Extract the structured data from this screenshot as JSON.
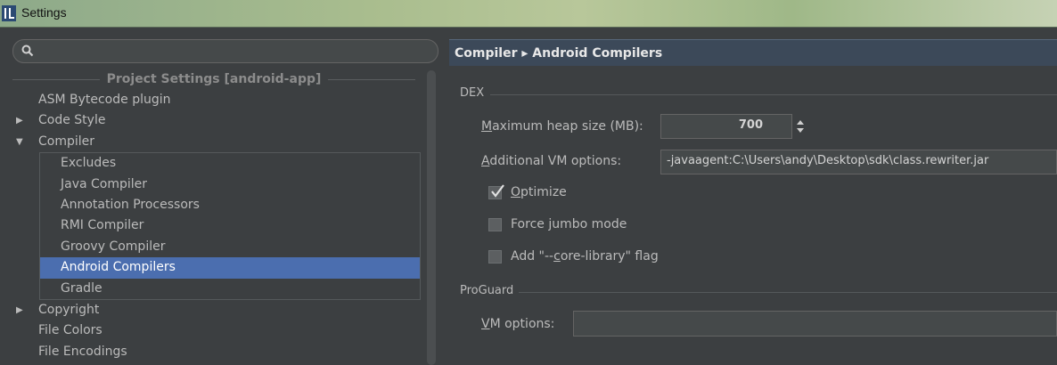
{
  "window": {
    "title": "Settings"
  },
  "search": {
    "placeholder": ""
  },
  "sidebar": {
    "section_title": "Project Settings [android-app]",
    "items": [
      {
        "label": "ASM Bytecode plugin",
        "arrow": ""
      },
      {
        "label": "Code Style",
        "arrow": "▶"
      },
      {
        "label": "Compiler",
        "arrow": "▼"
      }
    ],
    "compiler_children": [
      {
        "label": "Excludes"
      },
      {
        "label": "Java Compiler"
      },
      {
        "label": "Annotation Processors"
      },
      {
        "label": "RMI Compiler"
      },
      {
        "label": "Groovy Compiler"
      },
      {
        "label": "Android Compilers",
        "selected": true
      },
      {
        "label": "Gradle"
      }
    ],
    "items_after": [
      {
        "label": "Copyright",
        "arrow": "▶"
      },
      {
        "label": "File Colors",
        "arrow": ""
      },
      {
        "label": "File Encodings",
        "arrow": ""
      }
    ],
    "selected_color": "#4b6eaf"
  },
  "main": {
    "breadcrumb": "Compiler ▸ Android Compilers",
    "dex": {
      "group_label": "DEX",
      "heap_label_mnemonic": "M",
      "heap_label_rest": "aximum heap size (MB):",
      "heap_value": "700",
      "vm_label_mnemonic": "A",
      "vm_label_rest": "dditional VM options:",
      "vm_value": "-javaagent:C:\\Users\\andy\\Desktop\\sdk\\class.rewriter.jar",
      "optimize_mnemonic": "O",
      "optimize_rest": "ptimize",
      "optimize_checked": true,
      "jumbo_label": "Force jumbo mode",
      "jumbo_checked": false,
      "core_prefix": "Add \"--",
      "core_mnemonic": "c",
      "core_rest": "ore-library\" flag",
      "core_checked": false
    },
    "proguard": {
      "group_label": "ProGuard",
      "vm_label_mnemonic": "V",
      "vm_label_rest": "M options:",
      "vm_value": ""
    }
  }
}
